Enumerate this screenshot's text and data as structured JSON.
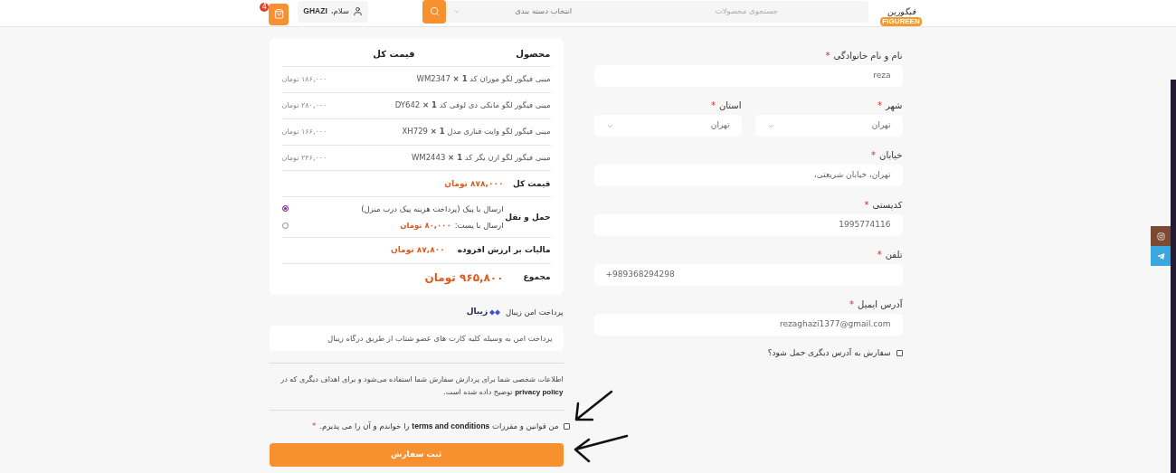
{
  "header": {
    "logo": {
      "script": "فیگورین",
      "badge": "FIGUREEN"
    },
    "search": {
      "placeholder": "جستجوی محصولات",
      "category": "انتخاب دسته بندی"
    },
    "user": {
      "greeting": "سلام،",
      "name": "GHAZI"
    },
    "cart": {
      "count": "4"
    }
  },
  "billing_form": {
    "fields": [
      {
        "kind": "text",
        "label": "نام و نام خانوادگی",
        "required_mark": "*",
        "value": "reza"
      },
      {
        "kind": "select",
        "label": "شهر",
        "required_mark": "*",
        "value": "تهران"
      },
      {
        "kind": "select",
        "label": "استان",
        "required_mark": "*",
        "value": "تهران"
      },
      {
        "kind": "text",
        "label": "خیابان",
        "required_mark": "*",
        "value": "تهران، خیابان شریعتی،"
      },
      {
        "kind": "text",
        "label": "کدپستی",
        "required_mark": "*",
        "value": "1995774116"
      },
      {
        "kind": "text",
        "label": "تلفن",
        "required_mark": "*",
        "value": "+989368294298",
        "ltr": true
      },
      {
        "kind": "text",
        "label": "آدرس ایمیل",
        "required_mark": "*",
        "value": "rezaghazi1377@gmail.com"
      }
    ],
    "ship_elsewhere": {
      "label": "سفارش به آدرس دیگری حمل شود؟",
      "checked": false
    }
  },
  "order_summary": {
    "columns": [
      "محصول",
      "قیمت کل"
    ],
    "items": [
      {
        "name": "مینی فیگور لگو موزان کد WM2347 **× 1**",
        "price": "۱۸۶,۰۰۰ تومان"
      },
      {
        "name": "مینی فیگور لگو مانکی دی لوفی کد DY642 **× 1**",
        "price": "۲۸۰,۰۰۰ تومان"
      },
      {
        "name": "مینی فیگور لگو وایت قناری مدل XH729 **× 1**",
        "price": "۱۶۶,۰۰۰ تومان"
      },
      {
        "name": "مینی فیگور لگو ارن یگر کد WM2443 **× 1**",
        "price": "۲۴۶,۰۰۰ تومان"
      }
    ],
    "subtotal": {
      "label": "قیمت کل",
      "value": "۸۷۸,۰۰۰ تومان"
    },
    "shipping": {
      "label": "حمل و نقل",
      "options": [
        {
          "text": "ارسال با پیک (پرداخت هزینه پیک درب منزل)",
          "selected": true
        },
        {
          "text": "ارسال با پست:",
          "price": "۸۰,۰۰۰ تومان",
          "selected": false
        }
      ]
    },
    "tax": {
      "label": "مالیات بر ارزش افزوده",
      "value": "۸۷,۸۰۰ تومان"
    },
    "total": {
      "label": "مجموع",
      "value": "۹۶۵,۸۰۰ تومان"
    }
  },
  "payment": {
    "title": "پرداخت امن زیبال",
    "logo": "زیبال",
    "description": "پرداخت امن به وسیله کلیه کارت های عضو شتاب از طریق درگاه زیبال"
  },
  "privacy": {
    "before": "اطلاعات شخصی شما برای پردازش سفارش شما استفاده می‌شود و برای اهداف دیگری که در",
    "link": "privacy policy",
    "after": "توضیح داده شده است."
  },
  "terms": {
    "before": "من قوانین و مقررات",
    "link": "terms and conditions",
    "after": "را خواندم و آن را می پذیرم.",
    "required_mark": "*",
    "checked": false
  },
  "submit": "ثبت سفارش"
}
